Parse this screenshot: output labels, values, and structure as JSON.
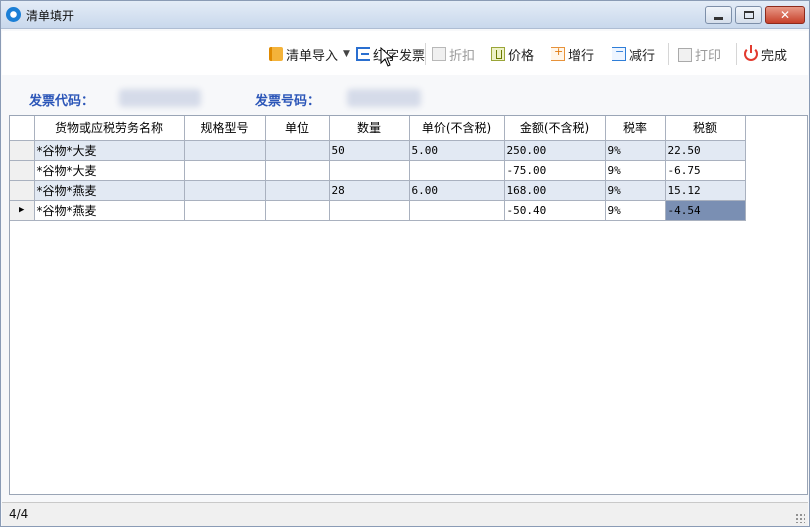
{
  "window": {
    "title": "清单填开"
  },
  "toolbar": {
    "import_label": "清单导入",
    "red_invoice_label": "红字发票",
    "discount_label": "折扣",
    "price_label": "价格",
    "add_row_label": "增行",
    "delete_row_label": "减行",
    "print_label": "打印",
    "finish_label": "完成"
  },
  "invoice": {
    "code_label": "发票代码：",
    "number_label": "发票号码："
  },
  "table": {
    "columns": [
      "货物或应税劳务名称",
      "规格型号",
      "单位",
      "数量",
      "单价(不含税)",
      "金额(不含税)",
      "税率",
      "税额"
    ],
    "rows": [
      {
        "name": "*谷物*大麦",
        "spec": "",
        "unit": "",
        "qty": "50",
        "price": "5.00",
        "amount": "250.00",
        "rate": "9%",
        "tax": "22.50"
      },
      {
        "name": "*谷物*大麦",
        "spec": "",
        "unit": "",
        "qty": "",
        "price": "",
        "amount": "-75.00",
        "rate": "9%",
        "tax": "-6.75"
      },
      {
        "name": "*谷物*燕麦",
        "spec": "",
        "unit": "",
        "qty": "28",
        "price": "6.00",
        "amount": "168.00",
        "rate": "9%",
        "tax": "15.12"
      },
      {
        "name": "*谷物*燕麦",
        "spec": "",
        "unit": "",
        "qty": "",
        "price": "",
        "amount": "-50.40",
        "rate": "9%",
        "tax": "-4.54"
      }
    ],
    "current_row_marker": "▶"
  },
  "status": {
    "text": "4/4"
  },
  "colors": {
    "label_blue": "#2c56b8",
    "alt_row": "#e2e9f3",
    "selected_cell": "#7a8fb3"
  }
}
